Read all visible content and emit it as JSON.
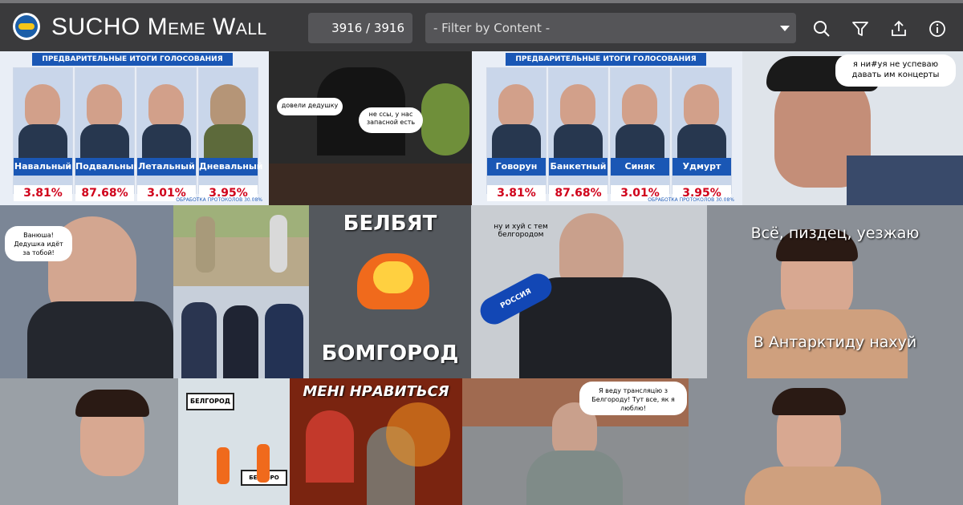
{
  "header": {
    "title": "SUCHO Meme Wall",
    "counter": "3916 / 3916",
    "filter_placeholder": "- Filter by Content -",
    "colors": {
      "bar": "#3a3a3c",
      "field": "#555558",
      "text": "#ffffff"
    },
    "tools": [
      "search-icon",
      "filter-icon",
      "share-icon",
      "info-icon"
    ]
  },
  "tiles": {
    "t1": {
      "banner": "ПРЕДВАРИТЕЛЬНЫЕ ИТОГИ ГОЛОСОВАНИЯ",
      "names": [
        "Навальный",
        "Подвальный",
        "Летальный",
        "Дневальный"
      ],
      "percents": [
        "3.81%",
        "87.68%",
        "3.01%",
        "3.95%"
      ],
      "footer": "ОБРАБОТКА ПРОТОКОЛОВ 30.08%"
    },
    "t2": {
      "bubble1": "довели дедушку",
      "bubble2": "не ссы, у нас запасной есть"
    },
    "t3": {
      "banner": "ПРЕДВАРИТЕЛЬНЫЕ ИТОГИ ГОЛОСОВАНИЯ",
      "names": [
        "Говорун",
        "Банкетный",
        "Синяк",
        "Удмурт"
      ],
      "percents": [
        "3.81%",
        "87.68%",
        "3.01%",
        "3.95%"
      ],
      "footer": "ОБРАБОТКА ПРОТОКОЛОВ 30.08%"
    },
    "t4": {
      "bubble": "я ни#уя не успеваю давать им концерты"
    },
    "t5": {
      "bubble": "Ванюша! Дедушка идёт за тобой!"
    },
    "t7": {
      "top": "БЕЛБЯТ",
      "bottom": "БОМГОРОД"
    },
    "t8": {
      "caption": "ну и хуй с тем белгородом",
      "mic": "РОССИЯ"
    },
    "t9": {
      "top": "Всё, пиздец, уезжаю",
      "bottom": "В Антарктиду нахуй"
    },
    "t10": {
      "sign": "БЕЛГОРОД",
      "sign2": "БЕЛГОРО"
    },
    "t11": {
      "top": "МЕНІ НРАВИТЬСЯ"
    },
    "t12": {
      "bubble": "Я веду трансляцію з Белгороду! Тут все, як я люблю!"
    }
  }
}
